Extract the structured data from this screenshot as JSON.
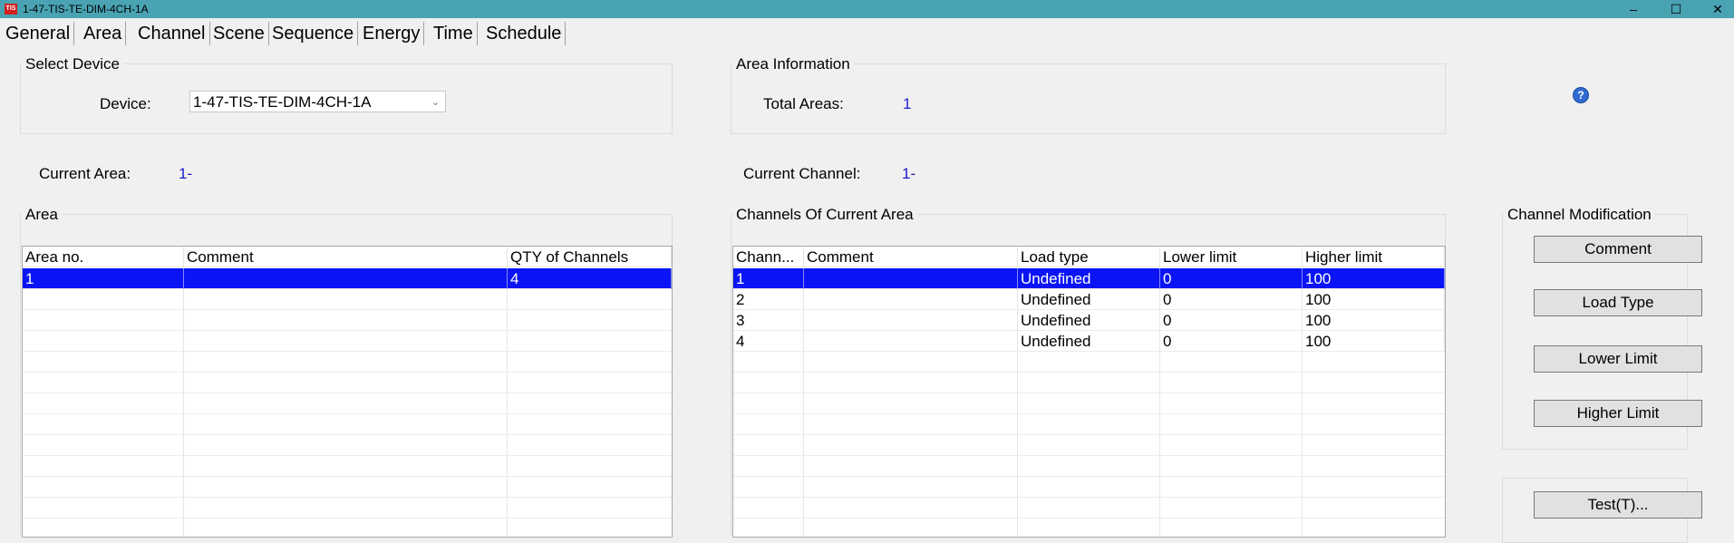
{
  "window": {
    "title": "1-47-TIS-TE-DIM-4CH-1A",
    "app_icon_text": "TIS",
    "minimize_glyph": "–",
    "maximize_glyph": "☐",
    "close_glyph": "✕"
  },
  "tabs": [
    "General",
    "Area",
    "Channel",
    "Scene",
    "Sequence",
    "Energy",
    "Time",
    "Schedule"
  ],
  "active_tab": "Channel",
  "select_device": {
    "title": "Select Device",
    "label": "Device:",
    "value": "1-47-TIS-TE-DIM-4CH-1A"
  },
  "area_information": {
    "title": "Area Information",
    "total_label": "Total Areas:",
    "total_value": "1"
  },
  "help_icon": "?",
  "current_area": {
    "label": "Current Area:",
    "value": "1-"
  },
  "current_channel": {
    "label": "Current Channel:",
    "value": "1-"
  },
  "area_grid": {
    "title": "Area",
    "columns": [
      "Area no.",
      "Comment",
      "QTY of Channels"
    ],
    "rows": [
      [
        "1",
        "",
        "4"
      ]
    ],
    "selected_row": 0
  },
  "channels_grid": {
    "title": "Channels Of Current Area",
    "columns": [
      "Chann...",
      "Comment",
      "Load type",
      "Lower limit",
      "Higher limit"
    ],
    "rows": [
      [
        "1",
        "",
        "Undefined",
        "0",
        "100"
      ],
      [
        "2",
        "",
        "Undefined",
        "0",
        "100"
      ],
      [
        "3",
        "",
        "Undefined",
        "0",
        "100"
      ],
      [
        "4",
        "",
        "Undefined",
        "0",
        "100"
      ]
    ],
    "selected_row": 0
  },
  "channel_modification": {
    "title": "Channel Modification",
    "comment_label": "Comment",
    "load_type_label": "Load Type",
    "lower_limit_label": "Lower Limit",
    "higher_limit_label": "Higher Limit"
  },
  "test_button_label": "Test(T)...",
  "colors": {
    "titlebar": "#49a3b3",
    "selection": "#0a14f5",
    "value_blue": "#1a1acc"
  }
}
